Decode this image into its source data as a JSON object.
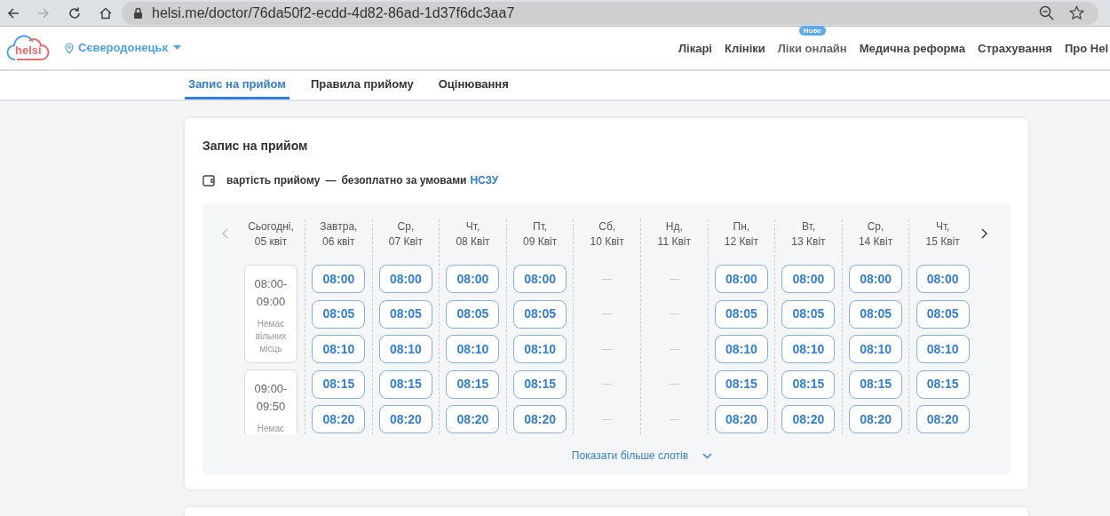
{
  "browser": {
    "url": "helsi.me/doctor/76da50f2-ecdd-4d82-86ad-1d37f6dc3aa7"
  },
  "header": {
    "logo": "helsi",
    "city": "Сєверодонецьк",
    "nav": [
      {
        "label": "Лікарі"
      },
      {
        "label": "Клініки"
      },
      {
        "label": "Ліки онлайн",
        "badge": "Нове"
      },
      {
        "label": "Медична реформа"
      },
      {
        "label": "Страхування"
      },
      {
        "label": "Про Hel"
      }
    ]
  },
  "tabs": [
    {
      "label": "Запис на прийом",
      "selected": true
    },
    {
      "label": "Правила прийому",
      "selected": false
    },
    {
      "label": "Оцінювання",
      "selected": false
    }
  ],
  "card": {
    "title": "Запис на прийом",
    "cost_label": "вартість прийому",
    "cost_sep": "—",
    "cost_value": "безоплатно за умовами",
    "cost_link": "НСЗУ"
  },
  "schedule": {
    "today": {
      "day": "Сьогодні,",
      "date": "05 квіт",
      "ranges": [
        {
          "time": "08:00-09:00",
          "note": "Немає вільних місць"
        },
        {
          "time": "09:00-09:50",
          "note": "Немає"
        }
      ]
    },
    "days": [
      {
        "kind": "open",
        "day": "Завтра,",
        "date": "06 квіт",
        "slots": [
          "08:00",
          "08:05",
          "08:10",
          "08:15",
          "08:20"
        ]
      },
      {
        "kind": "open",
        "day": "Ср,",
        "date": "07 Квіт",
        "slots": [
          "08:00",
          "08:05",
          "08:10",
          "08:15",
          "08:20"
        ]
      },
      {
        "kind": "open",
        "day": "Чт,",
        "date": "08 Квіт",
        "slots": [
          "08:00",
          "08:05",
          "08:10",
          "08:15",
          "08:20"
        ]
      },
      {
        "kind": "open",
        "day": "Пт,",
        "date": "09 Квіт",
        "slots": [
          "08:00",
          "08:05",
          "08:10",
          "08:15",
          "08:20"
        ]
      },
      {
        "kind": "closed",
        "day": "Сб,",
        "date": "10 Квіт"
      },
      {
        "kind": "closed",
        "day": "Нд,",
        "date": "11 Квіт"
      },
      {
        "kind": "open",
        "day": "Пн,",
        "date": "12 Квіт",
        "slots": [
          "08:00",
          "08:05",
          "08:10",
          "08:15",
          "08:20"
        ]
      },
      {
        "kind": "open",
        "day": "Вт,",
        "date": "13 Квіт",
        "slots": [
          "08:00",
          "08:05",
          "08:10",
          "08:15",
          "08:20"
        ]
      },
      {
        "kind": "open",
        "day": "Ср,",
        "date": "14 Квіт",
        "slots": [
          "08:00",
          "08:05",
          "08:10",
          "08:15",
          "08:20"
        ]
      },
      {
        "kind": "open",
        "day": "Чт,",
        "date": "15 Квіт",
        "slots": [
          "08:00",
          "08:05",
          "08:10",
          "08:15",
          "08:20"
        ]
      }
    ],
    "show_more": "Показати більше слотів"
  }
}
